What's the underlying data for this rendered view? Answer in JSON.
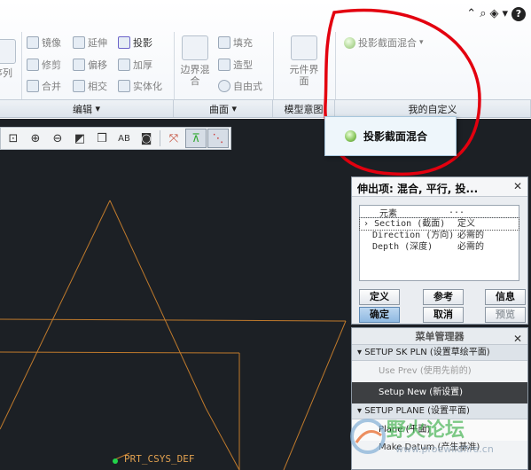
{
  "ribbon": {
    "left_item_label": "序列",
    "edit_group": {
      "mirror": "镜像",
      "extend": "延伸",
      "project": "投影",
      "trim": "修剪",
      "offset": "偏移",
      "thicken": "加厚",
      "merge": "合并",
      "intersect": "相交",
      "solidify": "实体化",
      "label": "编辑"
    },
    "surface_group": {
      "boundary_blend": "边界混合",
      "fill": "填充",
      "style": "造型",
      "freeform": "自由式",
      "label": "曲面"
    },
    "model_intent": {
      "component_interface": "元件界面",
      "label": "模型意图"
    },
    "my_custom": {
      "projected_section_blend": "投影截面混合",
      "label": "我的自定义"
    }
  },
  "popup": {
    "label": "投影截面混合"
  },
  "dialog": {
    "title": "伸出项: 混合, 平行, 投...",
    "column_header": "元素",
    "column_header2": "...",
    "rows": [
      {
        "element": "Section (截面)",
        "status": "定义"
      },
      {
        "element": "Direction (方向)",
        "status": "必需的"
      },
      {
        "element": "Depth (深度)",
        "status": "必需的"
      }
    ],
    "buttons": {
      "define": "定义",
      "reference": "参考",
      "info": "信息",
      "ok": "确定",
      "cancel": "取消",
      "preview": "预览"
    }
  },
  "menu_manager": {
    "title": "菜单管理器",
    "section1": "SETUP SK PLN (设置草绘平面)",
    "use_prev": "Use Prev (使用先前的)",
    "setup_new": "Setup New (新设置)",
    "section2": "SETUP PLANE (设置平面)",
    "plane": "Plane (平面)",
    "make_datum": "Make Datum (产生基准)"
  },
  "graphics": {
    "csys_label": "PRT_CSYS_DEF"
  },
  "watermark": {
    "name": "野火论坛",
    "url": "www.proewildfire.cn"
  },
  "colors": {
    "graphics_bg": "#1c2025",
    "geometry": "#c07a2c",
    "annotation": "#e3000f"
  }
}
